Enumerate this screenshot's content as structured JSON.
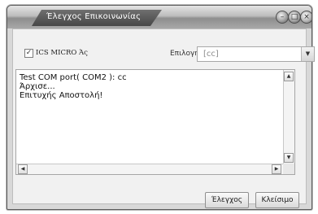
{
  "window": {
    "title": "Έλεγχος Επικοινωνίας",
    "controls": {
      "minimize": "–",
      "maximize": "□",
      "close": "×"
    }
  },
  "options": {
    "checkbox_label": "ICS MICRO Άς",
    "checkbox_checked": true,
    "select_label": "Επιλογή",
    "select_value": "[cc]"
  },
  "log": {
    "lines": [
      "Test COM port( COM2 ): cc",
      "Άρχισε...",
      "Επιτυχής Αποστολή!"
    ]
  },
  "buttons": {
    "check": "Έλεγχος",
    "close": "Κλείσιμο"
  }
}
